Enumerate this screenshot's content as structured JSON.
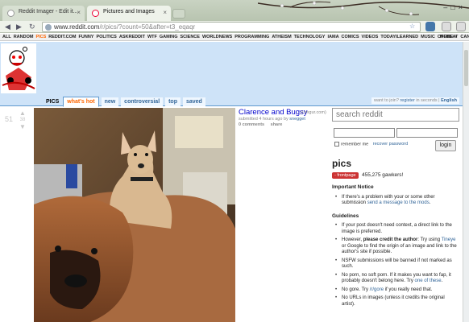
{
  "browser": {
    "tabs": [
      {
        "title": "Reddit Imager - Edit it...",
        "active": false
      },
      {
        "title": "Pictures and Images",
        "active": true
      }
    ],
    "url_main": "www.reddit.com",
    "url_rest": "/r/pics/?count=50&after=t3_eqaqr"
  },
  "srbar": {
    "items": [
      "ALL",
      "RANDOM",
      "PICS",
      "REDDIT.COM",
      "FUNNY",
      "POLITICS",
      "ASKREDDIT",
      "WTF",
      "GAMING",
      "SCIENCE",
      "WORLDNEWS",
      "PROGRAMMING",
      "ATHEISM",
      "TECHNOLOGY",
      "IAMA",
      "COMICS",
      "VIDEOS",
      "TODAYILEARNED",
      "MUSIC",
      "OFFBEAT",
      "CANADA"
    ],
    "selected": "PICS",
    "more": "MORE »"
  },
  "header": {
    "subreddit": "PICS",
    "tabs": [
      "what's hot",
      "new",
      "controversial",
      "top",
      "saved"
    ],
    "selected_tab": "what's hot",
    "userline_prefix": "want to join?",
    "register_link": "register",
    "userline_suffix": "in seconds |",
    "language": "English"
  },
  "post": {
    "rank": "51",
    "score": "38",
    "title": "Clarence and Bugsy",
    "domain": "(i.imgur.com)",
    "tagline_prefix": "submitted 4 hours ago by",
    "author": "snegget",
    "comments": "0 comments",
    "share": "share"
  },
  "sidebar": {
    "search_placeholder": "search reddit",
    "remember_label": "remember me",
    "recover_label": "recover password",
    "login_label": "login",
    "subreddit_title": "pics",
    "frontpage_label": "- frontpage",
    "gawkers": "455,275 gawkers!",
    "important_heading": "Important Notice",
    "important_items": [
      {
        "text": "If there's a problem with your or some other submission ",
        "link": "send a message to the mods",
        "after": "."
      }
    ],
    "guidelines_heading": "Guidelines",
    "guidelines": [
      {
        "text": "If your post doesn't need context, a direct link to the image is preferred.",
        "link": "",
        "after": ""
      },
      {
        "text": "However, ",
        "bold": "please credit the author",
        "text2": ": Try using ",
        "link": "Tineye",
        "after": " or Google to find the origin of an image and link to the author's site if possible."
      },
      {
        "text": "NSFW submissions will be banned if not marked as such.",
        "link": "",
        "after": ""
      },
      {
        "text": "No porn, no soft porn. If it makes you want to fap, it probably doesn't belong here. Try ",
        "link": "one of these",
        "after": "."
      },
      {
        "text": "No gore. Try ",
        "link": "/r/gore",
        "after": " if you really need that."
      },
      {
        "text": "No URLs in images (unless it credits the original artist).",
        "link": "",
        "after": ""
      }
    ]
  },
  "colors": {
    "header_bg": "#cee3f8",
    "accent_orange": "#ff6600",
    "link_blue": "#336699",
    "title_blue": "#0000cc"
  }
}
